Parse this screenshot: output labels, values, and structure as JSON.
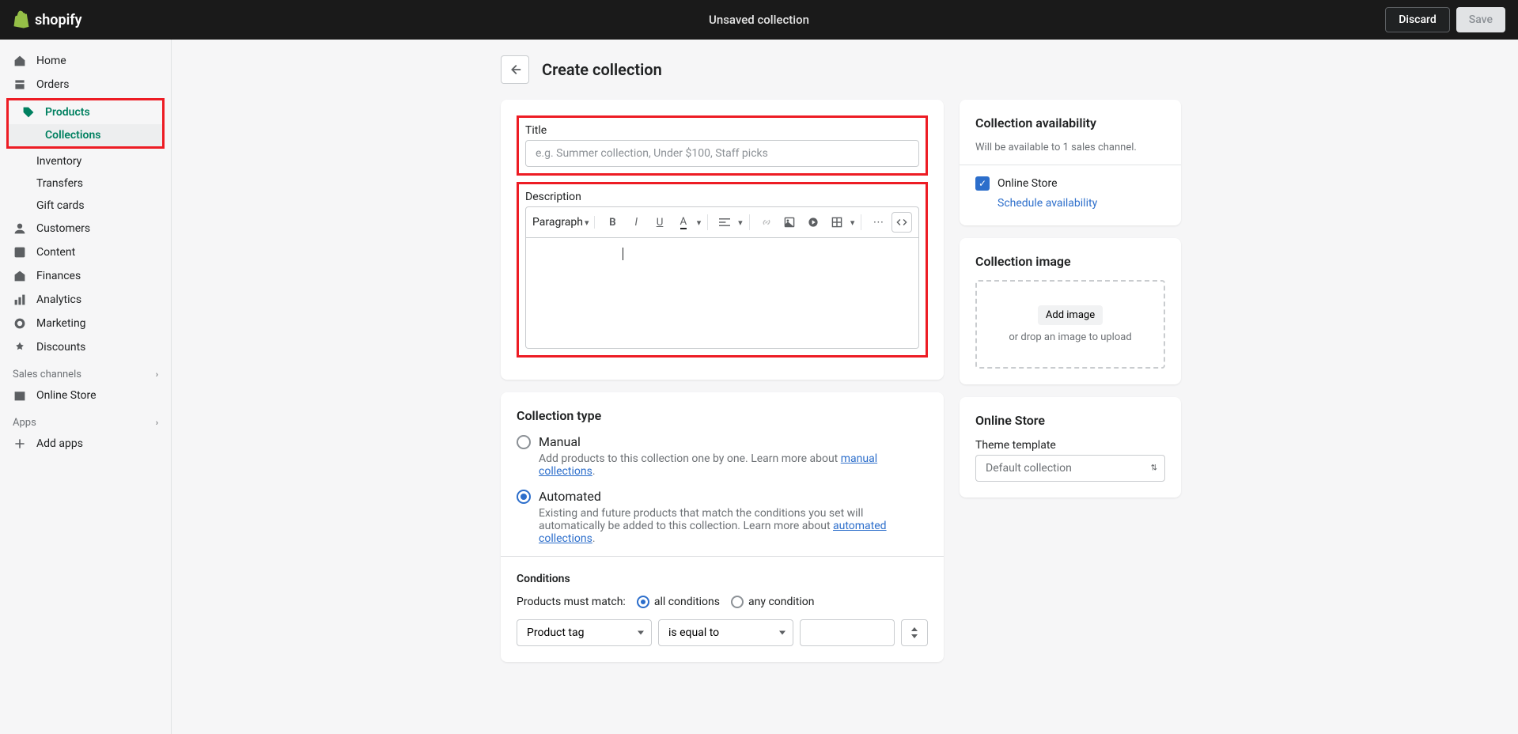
{
  "topbar": {
    "brand": "shopify",
    "status": "Unsaved collection",
    "discard": "Discard",
    "save": "Save"
  },
  "sidebar": {
    "home": "Home",
    "orders": "Orders",
    "products": "Products",
    "collections": "Collections",
    "inventory": "Inventory",
    "transfers": "Transfers",
    "gift_cards": "Gift cards",
    "customers": "Customers",
    "content": "Content",
    "finances": "Finances",
    "analytics": "Analytics",
    "marketing": "Marketing",
    "discounts": "Discounts",
    "sales_channels": "Sales channels",
    "online_store": "Online Store",
    "apps": "Apps",
    "add_apps": "Add apps"
  },
  "page": {
    "title": "Create collection"
  },
  "form": {
    "title_label": "Title",
    "title_placeholder": "e.g. Summer collection, Under $100, Staff picks",
    "desc_label": "Description",
    "paragraph": "Paragraph"
  },
  "collection_type": {
    "heading": "Collection type",
    "manual_label": "Manual",
    "manual_desc": "Add products to this collection one by one. Learn more about ",
    "manual_link": "manual collections",
    "auto_label": "Automated",
    "auto_desc1": "Existing and future products that match the conditions you set will automatically be added to this collection. Learn more about ",
    "auto_link": "automated collections"
  },
  "conditions": {
    "heading": "Conditions",
    "match_label": "Products must match:",
    "all": "all conditions",
    "any": "any condition",
    "field": "Product tag",
    "operator": "is equal to"
  },
  "availability": {
    "heading": "Collection availability",
    "subtext": "Will be available to 1 sales channel.",
    "online_store": "Online Store",
    "schedule": "Schedule availability"
  },
  "image": {
    "heading": "Collection image",
    "add": "Add image",
    "drop": "or drop an image to upload"
  },
  "theme": {
    "heading": "Online Store",
    "label": "Theme template",
    "value": "Default collection"
  }
}
